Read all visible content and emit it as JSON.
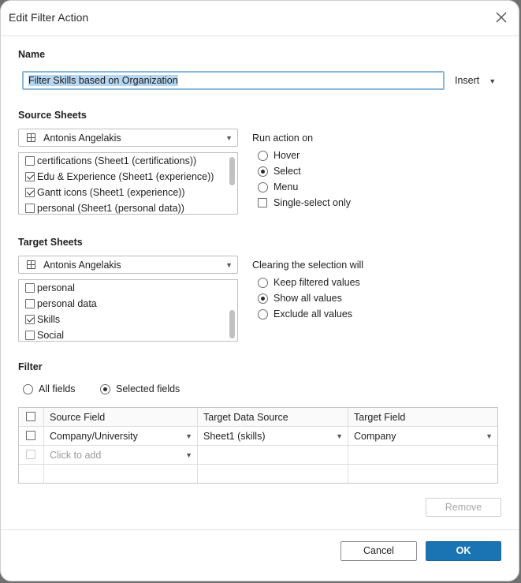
{
  "dialog": {
    "title": "Edit Filter Action",
    "close_icon": "close-icon"
  },
  "name": {
    "label": "Name",
    "value": "Filter Skills based on Organization",
    "insert_label": "Insert"
  },
  "source": {
    "label": "Source Sheets",
    "workbook": "Antonis Angelakis",
    "sheets": [
      {
        "label": "certifications (Sheet1 (certifications))",
        "checked": false
      },
      {
        "label": "Edu & Experience (Sheet1 (experience))",
        "checked": true
      },
      {
        "label": "Gantt icons (Sheet1 (experience))",
        "checked": true
      },
      {
        "label": "personal (Sheet1 (personal data))",
        "checked": false
      }
    ]
  },
  "run_action": {
    "label": "Run action on",
    "options": [
      {
        "label": "Hover",
        "selected": false
      },
      {
        "label": "Select",
        "selected": true
      },
      {
        "label": "Menu",
        "selected": false
      }
    ],
    "single_select_label": "Single-select only",
    "single_select_checked": false
  },
  "target": {
    "label": "Target Sheets",
    "workbook": "Antonis Angelakis",
    "sheets": [
      {
        "label": "personal",
        "checked": false
      },
      {
        "label": "personal data",
        "checked": false
      },
      {
        "label": "Skills",
        "checked": true
      },
      {
        "label": "Social",
        "checked": false
      }
    ]
  },
  "clearing": {
    "label": "Clearing the selection will",
    "options": [
      {
        "label": "Keep filtered values",
        "selected": false
      },
      {
        "label": "Show all values",
        "selected": true
      },
      {
        "label": "Exclude all values",
        "selected": false
      }
    ]
  },
  "filter": {
    "label": "Filter",
    "all_fields": "All fields",
    "selected_fields": "Selected fields",
    "selected_mode": "selected_fields",
    "columns": [
      "Source Field",
      "Target Data Source",
      "Target Field"
    ],
    "rows": [
      {
        "source_field": "Company/University",
        "target_data_source": "Sheet1 (skills)",
        "target_field": "Company"
      }
    ],
    "add_placeholder": "Click to add"
  },
  "buttons": {
    "remove": "Remove",
    "cancel": "Cancel",
    "ok": "OK"
  },
  "colors": {
    "accent": "#1a74b3",
    "selection_highlight": "#b7d6f2"
  }
}
